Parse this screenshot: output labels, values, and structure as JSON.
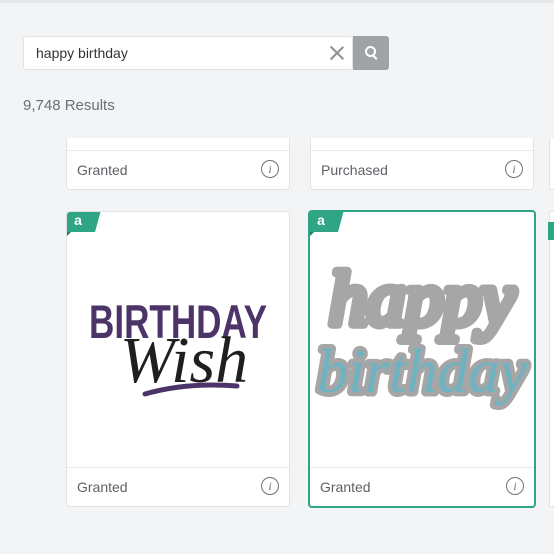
{
  "search": {
    "value": "happy birthday",
    "placeholder": "Search"
  },
  "results_count": "9,748 Results",
  "top_row": [
    {
      "status": "Granted"
    },
    {
      "status": "Purchased"
    }
  ],
  "cards": [
    {
      "status": "Granted",
      "badge": "a",
      "image": {
        "line1": "BIRTHDAY",
        "line2": "Wish"
      }
    },
    {
      "status": "Granted",
      "badge": "a",
      "image": {
        "line1": "happy",
        "line2": "birthday"
      }
    }
  ],
  "partial_badge": "a",
  "colors": {
    "accent": "#2fa585",
    "purple": "#4d3468",
    "teal": "#6fb3c2",
    "grey": "#a6a6a6"
  },
  "icons": {
    "clear": "close-icon",
    "search": "search-icon",
    "info": "info-icon"
  }
}
